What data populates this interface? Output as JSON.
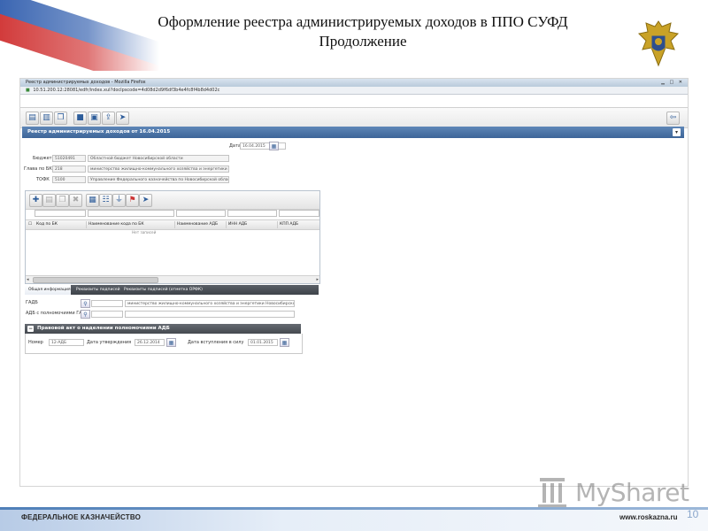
{
  "slide": {
    "title_line1": "Оформление реестра администрируемых доходов в ППО СУФД",
    "title_line2": "Продолжение",
    "footer_left": "ФЕДЕРАЛЬНОЕ КАЗНАЧЕЙСТВО",
    "footer_right": "www.roskazna.ru",
    "page_number": "10",
    "watermark": "MySharet"
  },
  "browser": {
    "window_title": "Реестр администрируемых доходов - Mozilla Firefox",
    "url": "10.51.200.12:28081/edfr/index.xul?docIpscode=4d08d2d9f6df3b4e4fc8f4b8d4d02c"
  },
  "panel": {
    "title": "Реестр администрируемых доходов от 16.04.2015"
  },
  "form": {
    "date_label": "Дата",
    "date_value": "16.04.2015",
    "budget_label": "Бюджет",
    "budget_code": "51020491",
    "budget_name": "Областной бюджет Новосибирской области",
    "glava_label": "Глава по БК",
    "glava_code": "218",
    "glava_name": "министерство жилищно-коммунального хозяйства и энергетики Ново",
    "tofk_label": "ТОФК",
    "tofk_code": "5100",
    "tofk_name": "Управление Федерального казначейства по Новосибирской области"
  },
  "grid": {
    "columns": [
      "Код по БК",
      "Наименование кода по БК",
      "Наименование АДБ",
      "ИНН АДБ",
      "КПП АДБ"
    ],
    "empty_text": "Нет записей"
  },
  "tabs": [
    "Общая информация",
    "Реквизиты подписей",
    "Реквизиты подписей (отметка ОРФК)"
  ],
  "details": {
    "gadb_label": "ГАДБ",
    "gadb_name": "министерство жилищно-коммунального хозяйства и энергетики Новосибирской обл",
    "adb_label": "АДБ с полномочиями ГАДБ",
    "adb_name": ""
  },
  "legal_act": {
    "title": "Правовой акт о наделении полномочиями АДБ",
    "number_label": "Номер",
    "number_value": "12-АДБ",
    "approval_label": "Дата утверждения",
    "approval_value": "26.12.2014",
    "effective_label": "Дата вступления в силу",
    "effective_value": "01.01.2015"
  },
  "colors": {
    "panel_header": "#3d6598",
    "section_header": "#45494f",
    "accent_blue": "#2e5d9a"
  }
}
